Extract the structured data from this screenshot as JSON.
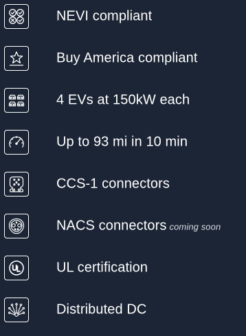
{
  "features": [
    {
      "label": "NEVI compliant",
      "icon": "nevi-checks-icon"
    },
    {
      "label": "Buy America compliant",
      "icon": "star-icon"
    },
    {
      "label": "4 EVs at 150kW each",
      "icon": "cars-icon"
    },
    {
      "label": "Up to 93 mi in 10 min",
      "icon": "speedometer-icon"
    },
    {
      "label": "CCS-1 connectors",
      "icon": "ccs1-connector-icon"
    },
    {
      "label": "NACS connectors",
      "note": "coming soon",
      "icon": "nacs-connector-icon"
    },
    {
      "label": "UL certification",
      "icon": "ul-logo-icon"
    },
    {
      "label": "Distributed DC",
      "icon": "distributed-dc-icon"
    }
  ],
  "colors": {
    "background": "#1c2535",
    "foreground": "#ffffff"
  }
}
